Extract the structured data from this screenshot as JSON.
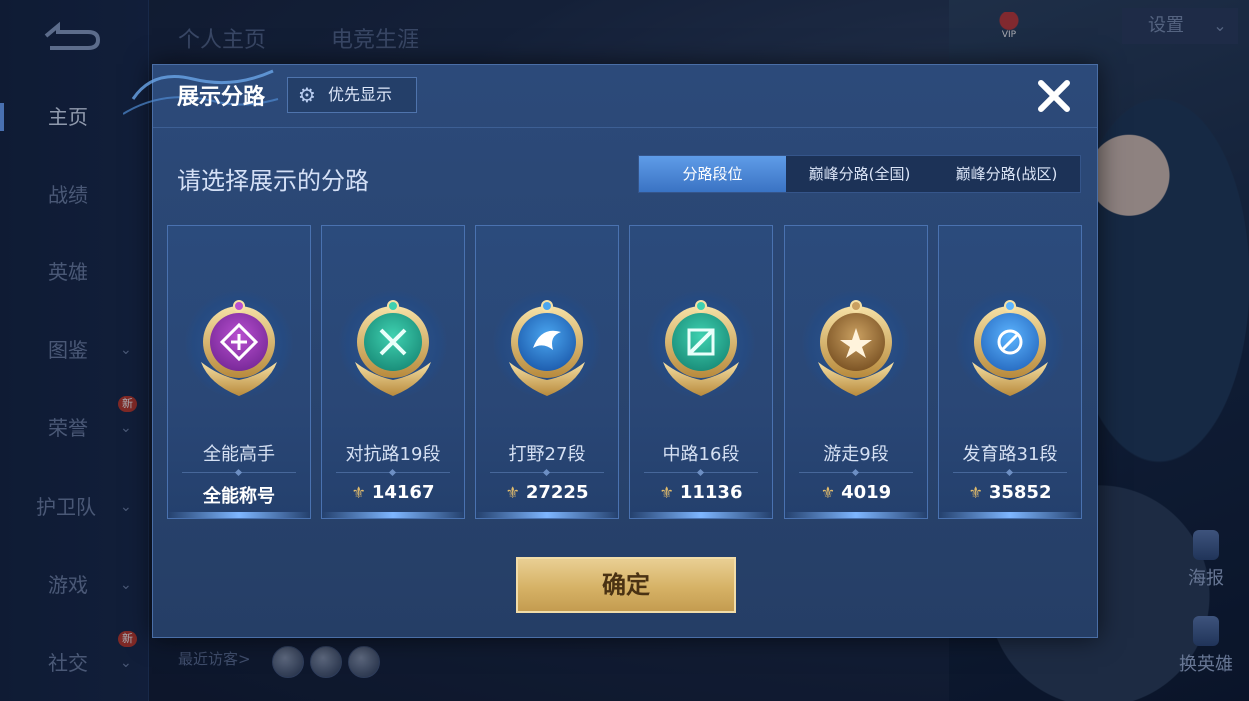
{
  "sidebar": {
    "items": [
      {
        "label": "主页",
        "active": true,
        "chevron": false,
        "badge": ""
      },
      {
        "label": "战绩",
        "active": false,
        "chevron": false,
        "badge": ""
      },
      {
        "label": "英雄",
        "active": false,
        "chevron": false,
        "badge": ""
      },
      {
        "label": "图鉴",
        "active": false,
        "chevron": true,
        "badge": ""
      },
      {
        "label": "荣誉",
        "active": false,
        "chevron": true,
        "badge": "新"
      },
      {
        "label": "护卫队",
        "active": false,
        "chevron": true,
        "badge": ""
      },
      {
        "label": "游戏",
        "active": false,
        "chevron": true,
        "badge": ""
      },
      {
        "label": "社交",
        "active": false,
        "chevron": true,
        "badge": "新"
      }
    ]
  },
  "header": {
    "tabs": [
      "个人主页",
      "电竞生涯"
    ],
    "settings_label": "设置",
    "vip_label": "VIP"
  },
  "footer": {
    "visitors_label": "最近访客>"
  },
  "right_buttons": {
    "poster": "海报",
    "change_hero": "换英雄"
  },
  "modal": {
    "title": "展示分路",
    "priority_label": "优先显示",
    "subtitle": "请选择展示的分路",
    "segments": [
      {
        "label": "分路段位",
        "active": true
      },
      {
        "label": "巅峰分路(全国)",
        "active": false
      },
      {
        "label": "巅峰分路(战区)",
        "active": false
      }
    ],
    "cards": [
      {
        "lane": "全能高手",
        "value": "全能称号",
        "has_peak_icon": false,
        "emblem": "purple-allround-emblem"
      },
      {
        "lane": "对抗路19段",
        "value": "14167",
        "has_peak_icon": true,
        "emblem": "green-clash-lane-emblem"
      },
      {
        "lane": "打野27段",
        "value": "27225",
        "has_peak_icon": true,
        "emblem": "blue-jungle-emblem"
      },
      {
        "lane": "中路16段",
        "value": "11136",
        "has_peak_icon": true,
        "emblem": "green-mid-lane-emblem"
      },
      {
        "lane": "游走9段",
        "value": "4019",
        "has_peak_icon": true,
        "emblem": "gold-roam-emblem"
      },
      {
        "lane": "发育路31段",
        "value": "35852",
        "has_peak_icon": true,
        "emblem": "blue-farm-lane-emblem"
      }
    ],
    "confirm_label": "确定"
  },
  "colors": {
    "accent_blue": "#3a73c4",
    "gold_button": "#d6b266",
    "peak_icon": "#e0bb6c"
  }
}
